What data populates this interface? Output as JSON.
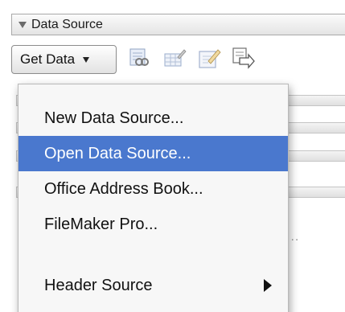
{
  "section": {
    "title": "Data Source"
  },
  "toolbar": {
    "get_data_label": "Get Data",
    "icons": [
      "find-record-icon",
      "edit-data-source-icon",
      "edit-recipients-icon",
      "merge-to-document-icon"
    ]
  },
  "menu": {
    "items": [
      {
        "label": "New Data Source...",
        "highlighted": false,
        "submenu": false
      },
      {
        "label": "Open Data Source...",
        "highlighted": true,
        "submenu": false
      },
      {
        "label": "Office Address Book...",
        "highlighted": false,
        "submenu": false
      },
      {
        "label": "FileMaker Pro...",
        "highlighted": false,
        "submenu": false
      },
      {
        "label": "Header Source",
        "highlighted": false,
        "submenu": true
      }
    ]
  },
  "colors": {
    "highlight": "#4a78ce",
    "menu_background": "#f7f7f7"
  }
}
